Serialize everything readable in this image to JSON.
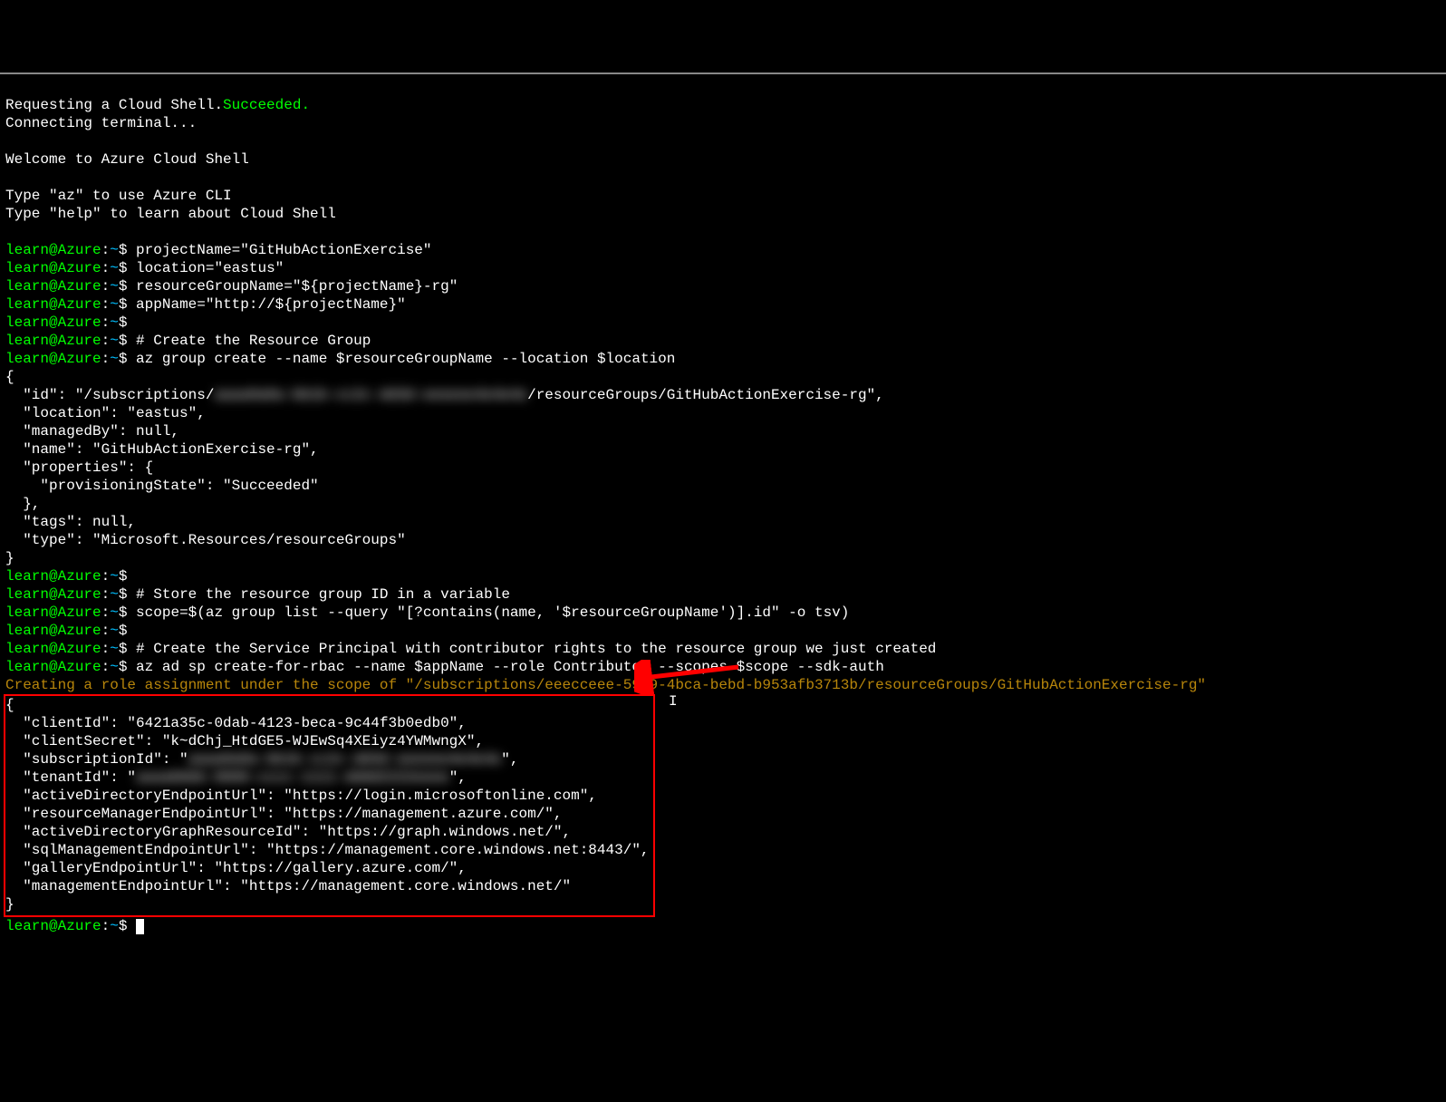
{
  "lines": {
    "requesting": "Requesting a Cloud Shell.",
    "succeeded": "Succeeded.",
    "connecting": "Connecting terminal...",
    "welcome": "Welcome to Azure Cloud Shell",
    "type_az": "Type \"az\" to use Azure CLI",
    "type_help": "Type \"help\" to learn about Cloud Shell"
  },
  "prompt": {
    "user_host": "learn@Azure",
    "colon": ":",
    "path": "~",
    "dollar": "$"
  },
  "commands": {
    "projectName": " projectName=\"GitHubActionExercise\"",
    "location": " location=\"eastus\"",
    "resourceGroupName": " resourceGroupName=\"${projectName}-rg\"",
    "appName": " appName=\"http://${projectName}\"",
    "empty": "",
    "comment_rg": " # Create the Resource Group",
    "az_group_create": " az group create --name $resourceGroupName --location $location",
    "comment_store": " # Store the resource group ID in a variable",
    "scope": " scope=$(az group list --query \"[?contains(name, '$resourceGroupName')].id\" -o tsv)",
    "comment_sp": " # Create the Service Principal with contributor rights to the resource group we just created",
    "az_ad_sp": " az ad sp create-for-rbac --name $appName --role Contributor --scopes $scope --sdk-auth"
  },
  "json_output1": {
    "open": "{",
    "id_pre": "  \"id\": \"/subscriptions/",
    "id_blur": "aaaa0a0a-bb1b-cc2c-dd3d-eeeeee4e4e4e",
    "id_post": "/resourceGroups/GitHubActionExercise-rg\",",
    "location": "  \"location\": \"eastus\",",
    "managedBy": "  \"managedBy\": null,",
    "name": "  \"name\": \"GitHubActionExercise-rg\",",
    "properties": "  \"properties\": {",
    "provisioning": "    \"provisioningState\": \"Succeeded\"",
    "close_prop": "  },",
    "tags": "  \"tags\": null,",
    "type": "  \"type\": \"Microsoft.Resources/resourceGroups\"",
    "close": "}"
  },
  "role_msg": "Creating a role assignment under the scope of \"/subscriptions/eeecceee-5989-4bca-bebd-b953afb3713b/resourceGroups/GitHubActionExercise-rg\"",
  "json_output2": {
    "open": "{",
    "clientId": "  \"clientId\": \"6421a35c-0dab-4123-beca-9c44f3b0edb0\",",
    "clientSecret": "  \"clientSecret\": \"k~dChj_HtdGE5-WJEwSq4XEiyz4YWMwngX\",",
    "subscriptionId_pre": "  \"subscriptionId\": \"",
    "subscriptionId_blur": "aaaa0a0a-bb1b-cc2c-dd3d-eeeeee4e4e4e",
    "subscriptionId_post": "\",",
    "tenantId_pre": "  \"tenantId\": \"",
    "tenantId_blur": "aaaabbbb-0000-cccc-1111-dddd2222eeee",
    "tenantId_post": "\",",
    "adEndpoint": "  \"activeDirectoryEndpointUrl\": \"https://login.microsoftonline.com\",",
    "rmEndpoint": "  \"resourceManagerEndpointUrl\": \"https://management.azure.com/\",",
    "adGraph": "  \"activeDirectoryGraphResourceId\": \"https://graph.windows.net/\",",
    "sqlMgmt": "  \"sqlManagementEndpointUrl\": \"https://management.core.windows.net:8443/\",",
    "gallery": "  \"galleryEndpointUrl\": \"https://gallery.azure.com/\",",
    "mgmtEndpoint": "  \"managementEndpointUrl\": \"https://management.core.windows.net/\"",
    "close": "}"
  }
}
